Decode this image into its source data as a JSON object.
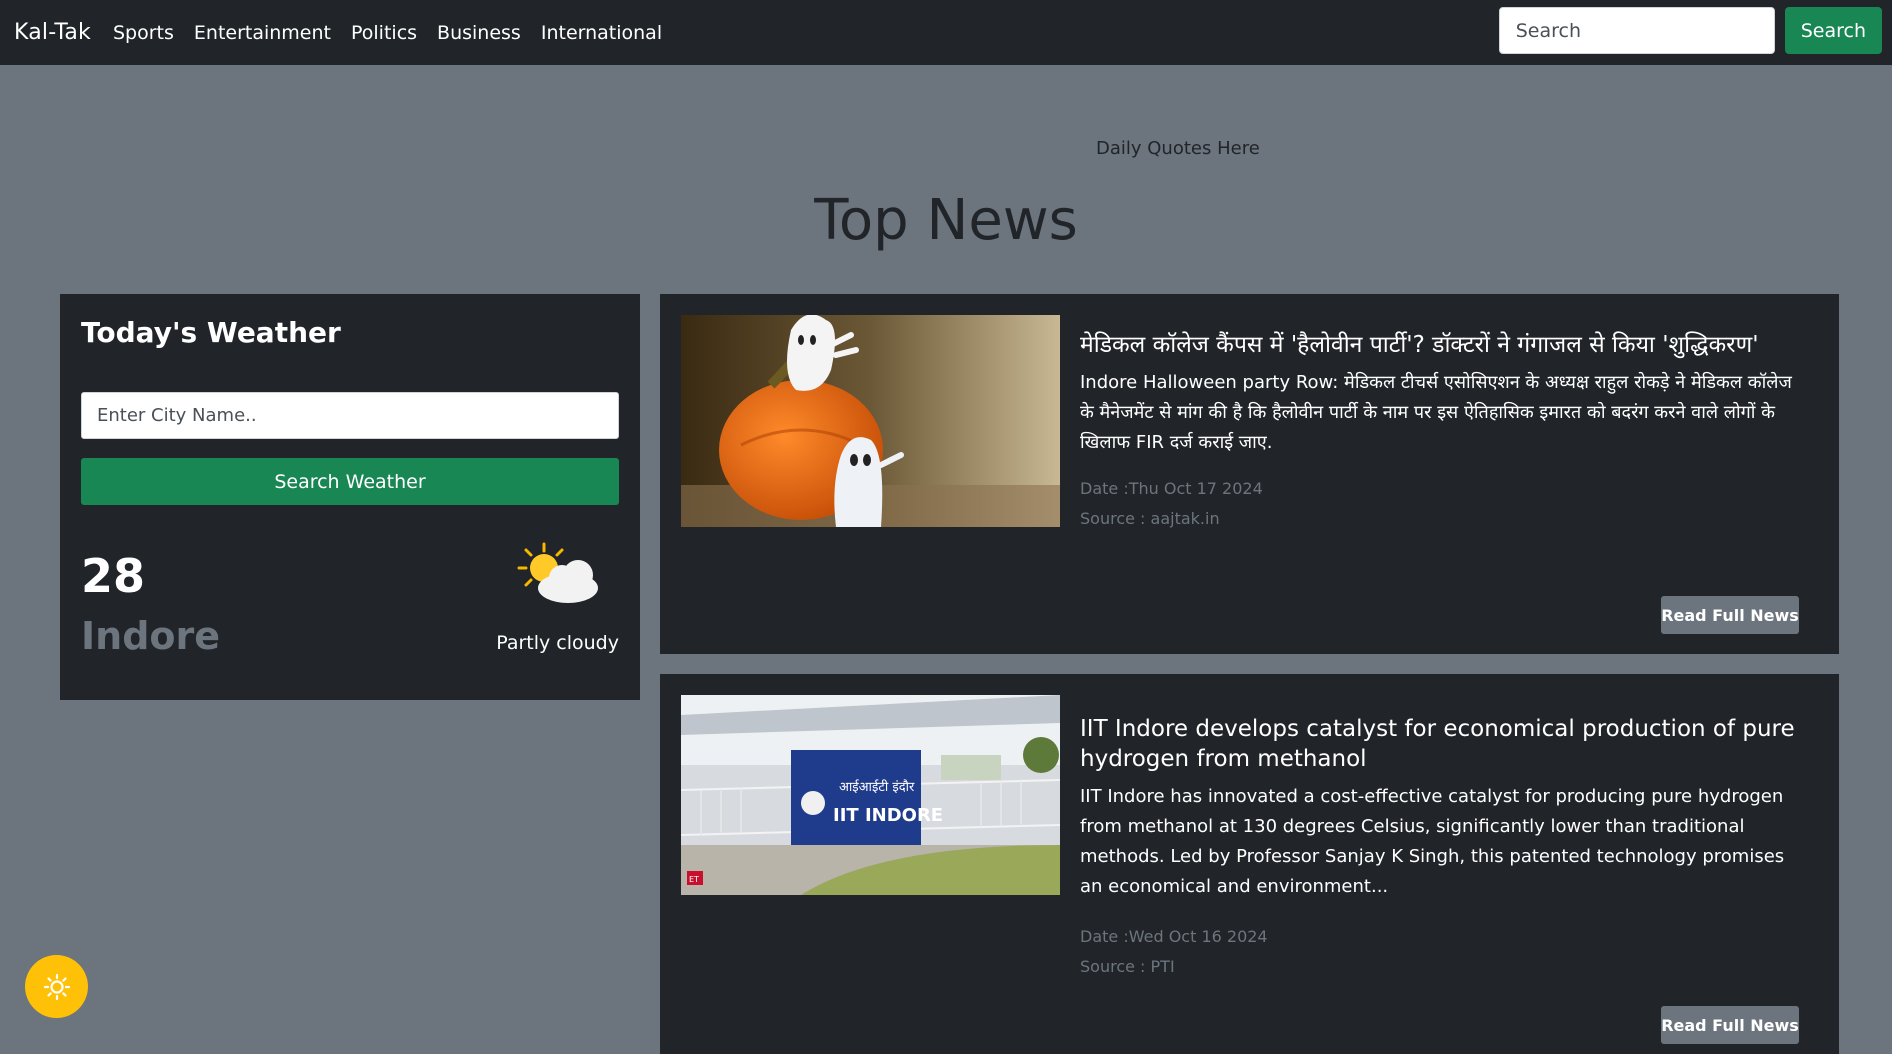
{
  "navbar": {
    "brand": "Kal-Tak",
    "links": [
      "Sports",
      "Entertainment",
      "Politics",
      "Business",
      "International"
    ],
    "search_placeholder": "Search",
    "search_button": "Search"
  },
  "quote": "Daily Quotes Here",
  "heading": "Top News",
  "weather": {
    "title": "Today's Weather",
    "city_placeholder": "Enter City Name..",
    "button": "Search Weather",
    "temperature": "28",
    "city": "Indore",
    "condition": "Partly cloudy",
    "icon": "partly-cloudy-icon"
  },
  "news": [
    {
      "title": "मेडिकल कॉलेज कैंपस में 'हैलोवीन पार्टी'? डॉक्टरों ने गंगाजल से किया 'शुद्धिकरण'",
      "description": "Indore Halloween party Row: मेडिकल टीचर्स एसोसिएशन के अध्यक्ष राहुल रोकड़े ने मेडिकल कॉलेज के मैनेजमेंट से मांग की है कि हैलोवीन पार्टी के नाम पर इस ऐतिहासिक इमारत को बदरंग करने वाले लोगों के खिलाफ FIR दर्ज कराई जाए.",
      "date": "Date :Thu Oct 17 2024",
      "source": "Source : aajtak.in",
      "button": "Read Full News",
      "image": "halloween-pumpkin-ghosts-image"
    },
    {
      "title": "IIT Indore develops catalyst for economical production of pure hydrogen from methanol",
      "description": "IIT Indore has innovated a cost-effective catalyst for producing pure hydrogen from methanol at 130 degrees Celsius, significantly lower than traditional methods. Led by Professor Sanjay K Singh, this patented technology promises an economical and environment...",
      "date": "Date :Wed Oct 16 2024",
      "source": "Source : PTI",
      "button": "Read Full News",
      "image": "iit-indore-gate-image",
      "image_sign": "आईआईटी इंदौर",
      "image_sign_en": "IIT INDORE",
      "image_badge": "ET"
    }
  ],
  "theme_toggle_icon": "sun-icon"
}
